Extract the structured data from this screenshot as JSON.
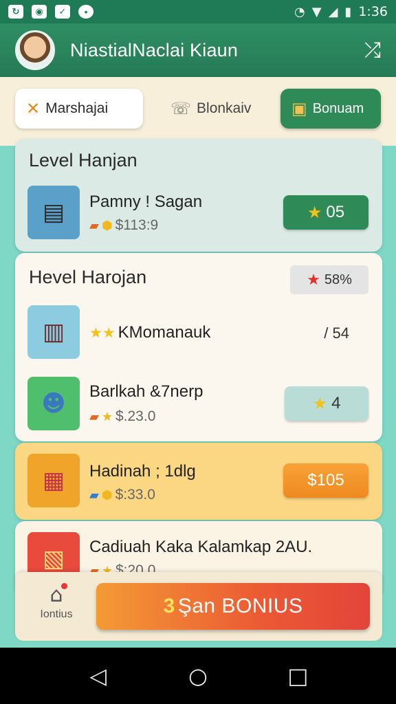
{
  "status_bar": {
    "time": "1:36",
    "left_icons": [
      "sync-icon",
      "camera-icon",
      "check-icon",
      "location-icon"
    ],
    "right_icons": [
      "alarm-icon",
      "wifi-icon",
      "signal-icon",
      "battery-icon"
    ]
  },
  "app_bar": {
    "title": "NiastialNaclai Kiaun",
    "share_icon": "share-icon"
  },
  "tabs": [
    {
      "label": "Marshajai",
      "icon": "crossed-tools-icon",
      "active": true
    },
    {
      "label": "Blonkaiv",
      "icon": "chat-icon",
      "active": false
    },
    {
      "label": "Bonuam",
      "icon": "treasure-icon",
      "active": false
    }
  ],
  "sections": {
    "level1": {
      "title": "Level Hanjan",
      "item": {
        "name": "Pamny ! Sagan",
        "price": "$113:9",
        "button": "05"
      }
    },
    "level2": {
      "title": "Hevel Harojan",
      "badge": "58%",
      "items": [
        {
          "name": "KMomanauk",
          "side_value": "/ 54"
        },
        {
          "name": "Barlkah &7nerp",
          "price": "$.23.0",
          "button": "4"
        }
      ]
    },
    "level3": {
      "item": {
        "name": "Hadinah ; 1dlg",
        "price": "$:33.0",
        "button": "$105"
      }
    },
    "level4": {
      "item": {
        "name": "Cadiuah Kaka Kalamkap 2AU.",
        "price": "$:20.0"
      }
    }
  },
  "bottom": {
    "home_label": "Iontius",
    "spin_number": "3",
    "spin_label": "Şan BONIUS"
  },
  "nav": {
    "back": "back-icon",
    "home": "home-icon",
    "recents": "recents-icon"
  },
  "colors": {
    "primary_green": "#2e8b57",
    "header_green": "#257a55",
    "teal_bg": "#7fd8c6",
    "cream": "#f7efd9",
    "orange": "#ee8a20",
    "red": "#e3443a",
    "gold_star": "#f1c21b"
  }
}
